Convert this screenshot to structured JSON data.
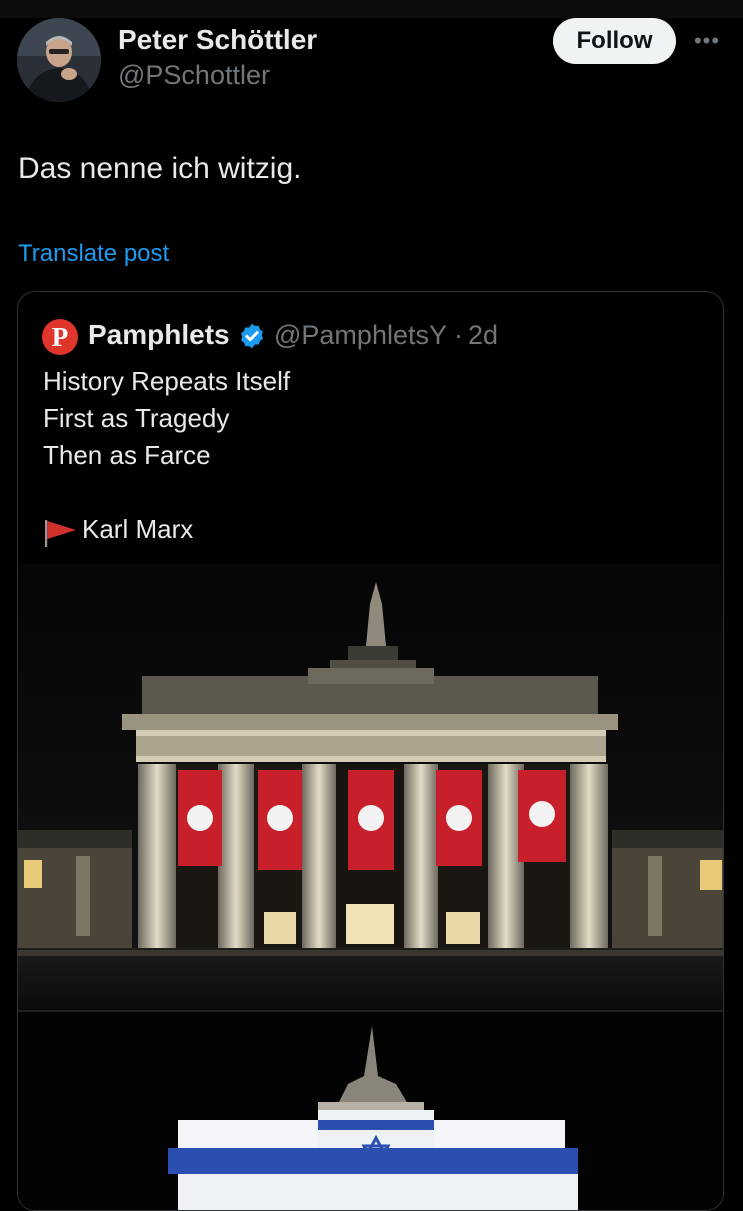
{
  "post": {
    "author_name": "Peter Schöttler",
    "author_handle": "@PSchottler",
    "follow_label": "Follow",
    "more_icon": "more-horizontal-icon",
    "text": "Das nenne ich witzig.",
    "translate_label": "Translate post"
  },
  "quote": {
    "logo_letter": "P",
    "name": "Pamphlets",
    "verified_icon": "verified-badge-icon",
    "handle": "@PamphletsY",
    "separator": "·",
    "time": "2d",
    "lines": [
      "History Repeats Itself",
      "First as Tragedy",
      "Then as Farce"
    ],
    "flag_icon": "red-flag-icon",
    "attribution": "Karl Marx"
  },
  "colors": {
    "background": "#000000",
    "text_primary": "#e7e9ea",
    "text_secondary": "#71767b",
    "link": "#1d9bf0",
    "verified": "#1d9bf0",
    "logo_red": "#e0352b",
    "flag_red": "#d0312d",
    "banner_red": "#c8202a",
    "israel_blue": "#2b4fb0"
  }
}
